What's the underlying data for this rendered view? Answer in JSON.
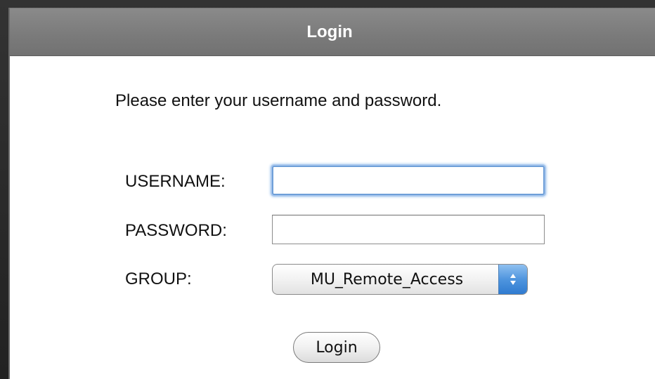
{
  "dialog": {
    "title": "Login",
    "prompt": "Please enter your username and password."
  },
  "form": {
    "username_label": "USERNAME:",
    "username_value": "",
    "password_label": "PASSWORD:",
    "password_value": "",
    "group_label": "GROUP:",
    "group_selected": "MU_Remote_Access",
    "submit_label": "Login"
  },
  "icons": {
    "select_arrows": "up-down-chevron-icon"
  },
  "colors": {
    "titlebar": "#7a7a7a",
    "focus_ring": "#6e9fd8",
    "select_arrow_bg": "#4f95de"
  }
}
